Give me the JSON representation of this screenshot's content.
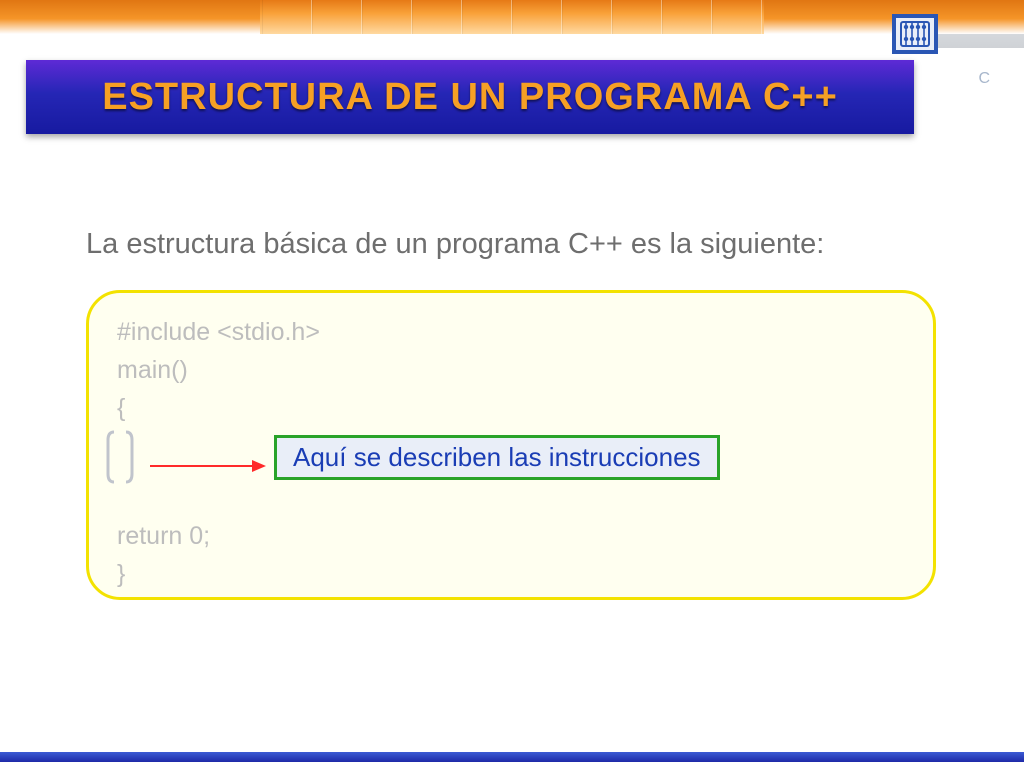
{
  "colors": {
    "title_text": "#f6a024",
    "title_bg_top": "#5e2ad6",
    "title_bg_bottom": "#171aa0",
    "code_border": "#f3e200",
    "code_bg": "#fffff0",
    "callout_border": "#29a329",
    "callout_bg": "#e9eef8",
    "callout_text": "#1a3db5",
    "arrow": "#ff2a2a"
  },
  "header": {
    "title": "ESTRUCTURA DE UN PROGRAMA C++",
    "side_letters": "C"
  },
  "intro": "La estructura básica de un programa C++ es la siguiente:",
  "code": {
    "line1": "#include <stdio.h>",
    "line2": "main()",
    "line3": "{",
    "line4_blank": "",
    "line5": "return 0;",
    "line6": "}"
  },
  "callout": {
    "text": "Aquí se describen las instrucciones"
  },
  "icons": {
    "logo": "abacus-icon"
  }
}
